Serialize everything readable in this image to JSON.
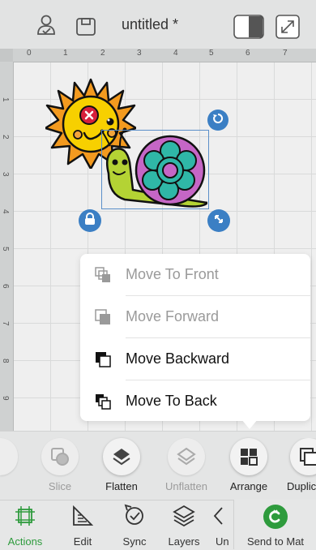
{
  "header": {
    "title": "untitled *",
    "icons": [
      "profile-icon",
      "save-icon",
      "panel-toggle-icon",
      "fullscreen-icon"
    ]
  },
  "rulers": {
    "horizontal": [
      "0",
      "1",
      "2",
      "3",
      "4",
      "5",
      "6",
      "7"
    ],
    "vertical": [
      "1",
      "2",
      "3",
      "4",
      "5",
      "6",
      "7",
      "8",
      "9"
    ]
  },
  "arrange_menu": {
    "items": [
      {
        "label": "Move To Front",
        "enabled": false
      },
      {
        "label": "Move Forward",
        "enabled": false
      },
      {
        "label": "Move Backward",
        "enabled": true
      },
      {
        "label": "Move To Back",
        "enabled": true
      }
    ]
  },
  "toolbar": {
    "slice": "Slice",
    "flatten": "Flatten",
    "unflatten": "Unflatten",
    "arrange": "Arrange",
    "duplicate": "Duplic"
  },
  "bottom_nav": {
    "actions": "Actions",
    "edit": "Edit",
    "sync": "Sync",
    "layers": "Layers",
    "undo": "Un",
    "send_to_mat": "Send to Mat"
  },
  "colors": {
    "accent_green": "#2e9b3d",
    "handle_blue": "#3b7fc4",
    "selection_box": "#5b8fc9"
  }
}
